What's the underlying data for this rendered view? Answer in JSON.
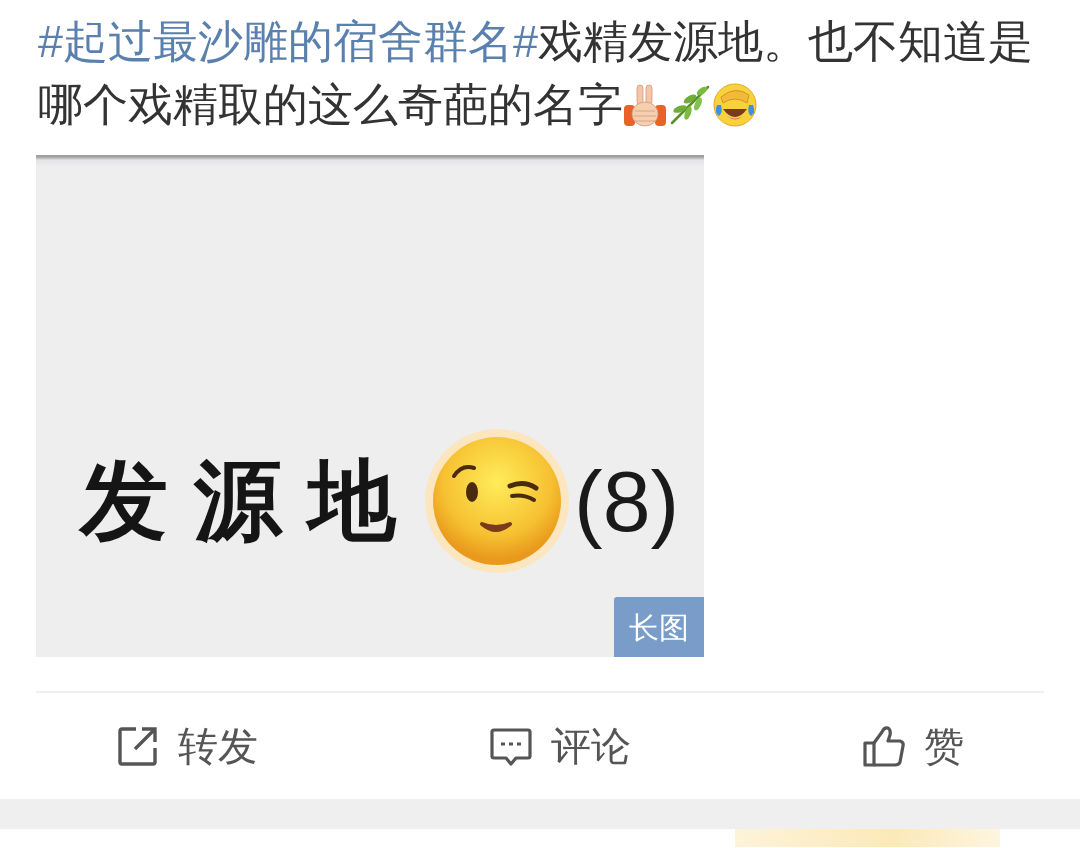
{
  "post": {
    "topic": "#起过最沙雕的宿舍群名#",
    "text": "戏精发源地。也不知道是哪个戏精取的这么奇葩的名字",
    "emoticons": [
      {
        "kind": "hands"
      },
      {
        "kind": "branch"
      },
      {
        "kind": "laughing"
      }
    ]
  },
  "image": {
    "text": "发源地",
    "count": "(8)",
    "badge": "长图"
  },
  "actions": [
    {
      "kind": "repost",
      "label": "转发"
    },
    {
      "kind": "comment",
      "label": "评论"
    },
    {
      "kind": "like",
      "label": "赞"
    }
  ]
}
